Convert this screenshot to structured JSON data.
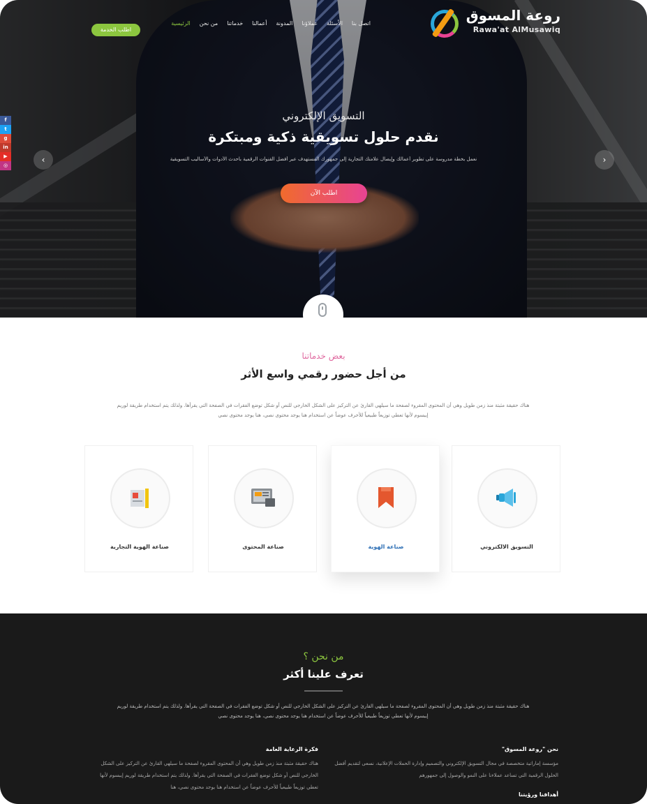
{
  "nav": {
    "logo_ar": "روعة المسوق",
    "logo_en": "Rawa'at AlMusawiq",
    "menu": [
      "الرئيسية",
      "من نحن",
      "خدماتنا",
      "أعمالنا",
      "المدونة",
      "عملاؤنا",
      "الأسئلة",
      "اتصل بنا"
    ],
    "cta": "اطلب الخدمة"
  },
  "social": [
    {
      "icon": "facebook-icon",
      "glyph": "f",
      "color": "#3b5998"
    },
    {
      "icon": "twitter-icon",
      "glyph": "t",
      "color": "#1da1f2"
    },
    {
      "icon": "google-plus-icon",
      "glyph": "g",
      "color": "#dd4b39"
    },
    {
      "icon": "linkedin-icon",
      "glyph": "in",
      "color": "#c0392b"
    },
    {
      "icon": "youtube-icon",
      "glyph": "▶",
      "color": "#e52d27"
    },
    {
      "icon": "instagram-icon",
      "glyph": "◎",
      "color": "#c13584"
    }
  ],
  "hero": {
    "eyebrow": "التسويق الإلكتروني",
    "title": "نقدم حلول تسويقية ذكية ومبتكرة",
    "description": "نعمل بخطة مدروسة على تطوير أعمالك وإيصال علامتك التجارية إلى جمهورك المستهدف عبر أفضل القنوات الرقمية بأحدث الأدوات والأساليب التسويقية",
    "cta": "اطلب الآن"
  },
  "services": {
    "eyebrow": "بعض خدماتنا",
    "title": "من أجل حضور رقمي واسع الأثر",
    "description": "هناك حقيقة مثبتة منذ زمن طويل وهي أن المحتوى المقروء لصفحة ما سيلهي القارئ عن التركيز على الشكل الخارجي للنص أو شكل توضع الفقرات في الصفحة التي يقرأها. ولذلك يتم استخدام طريقة لوريم إيبسوم لأنها تعطي توزيعاً طبيعياً للأحرف عوضاً عن استخدام هنا يوجد محتوى نصي، هنا يوجد محتوى نصي",
    "items": [
      {
        "label": "التسويق الالكتروني",
        "icon": "megaphone-icon"
      },
      {
        "label": "صناعة الهوية",
        "icon": "bookmark-icon"
      },
      {
        "label": "صناعة المحتوى",
        "icon": "content-monitor-icon"
      },
      {
        "label": "صناعة الهوية التجارية",
        "icon": "brand-identity-icon"
      }
    ]
  },
  "about": {
    "eyebrow": "من نحن ؟",
    "title": "تعرف علينا أكثر",
    "description": "هناك حقيقة مثبتة منذ زمن طويل وهي أن المحتوى المقروء لصفحة ما سيلهي القارئ عن التركيز على الشكل الخارجي للنص أو شكل توضع الفقرات في الصفحة التي يقرأها. ولذلك يتم استخدام طريقة لوريم إيبسوم لأنها تعطي توزيعاً طبيعياً للأحرف عوضاً عن استخدام هنا يوجد محتوى نصي، هنا يوجد محتوى نصي",
    "col_right_title": "نحن \"روعة المسوق\"",
    "col_right_text": "مؤسسة إماراتية متخصصة في مجال التسويق الإلكتروني والتصميم وإدارة الحملات الإعلانية، نسعى لتقديم أفضل الحلول الرقمية التي تساعد عملاءنا على النمو والوصول إلى جمهورهم",
    "col_right_sub": "أهدافنا ورؤيتنا",
    "col_left_title": "فكرة الرعاية العامة",
    "col_left_text": "هناك حقيقة مثبتة منذ زمن طويل وهي أن المحتوى المقروء لصفحة ما سيلهي القارئ عن التركيز على الشكل الخارجي للنص أو شكل توضع الفقرات في الصفحة التي يقرأها. ولذلك يتم استخدام طريقة لوريم إيبسوم لأنها تعطي توزيعاً طبيعياً للأحرف عوضاً عن استخدام هنا يوجد محتوى نصي، هنا"
  },
  "colors": {
    "accent_green": "#8cc63f",
    "accent_pink": "#e84393",
    "accent_orange": "#f06b2c",
    "accent_blue": "#2d6fb5",
    "dark_bg": "#1a1a1a"
  }
}
